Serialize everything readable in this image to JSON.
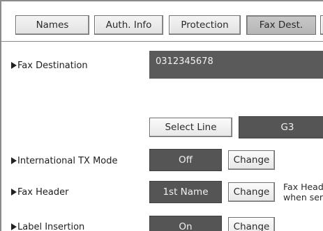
{
  "tabs": [
    {
      "label": "Names",
      "selected": false
    },
    {
      "label": "Auth. Info",
      "selected": false
    },
    {
      "label": "Protection",
      "selected": false
    },
    {
      "label": "Fax Dest.",
      "selected": true
    },
    {
      "label": "",
      "selected": false
    }
  ],
  "fax_destination": {
    "label": "Fax Destination",
    "value": "0312345678"
  },
  "line": {
    "select_label": "Select Line",
    "value": "G3"
  },
  "international_tx": {
    "label": "International TX Mode",
    "value": "Off",
    "change_label": "Change"
  },
  "fax_header": {
    "label": "Fax Header",
    "value": "1st Name",
    "change_label": "Change",
    "note_line1": "Fax Head",
    "note_line2": "when ser"
  },
  "label_insertion": {
    "label": "Label Insertion",
    "value": "On",
    "change_label": "Change"
  },
  "colors": {
    "dark_value": "#555555",
    "tab_selected": "#bdbdbd"
  }
}
